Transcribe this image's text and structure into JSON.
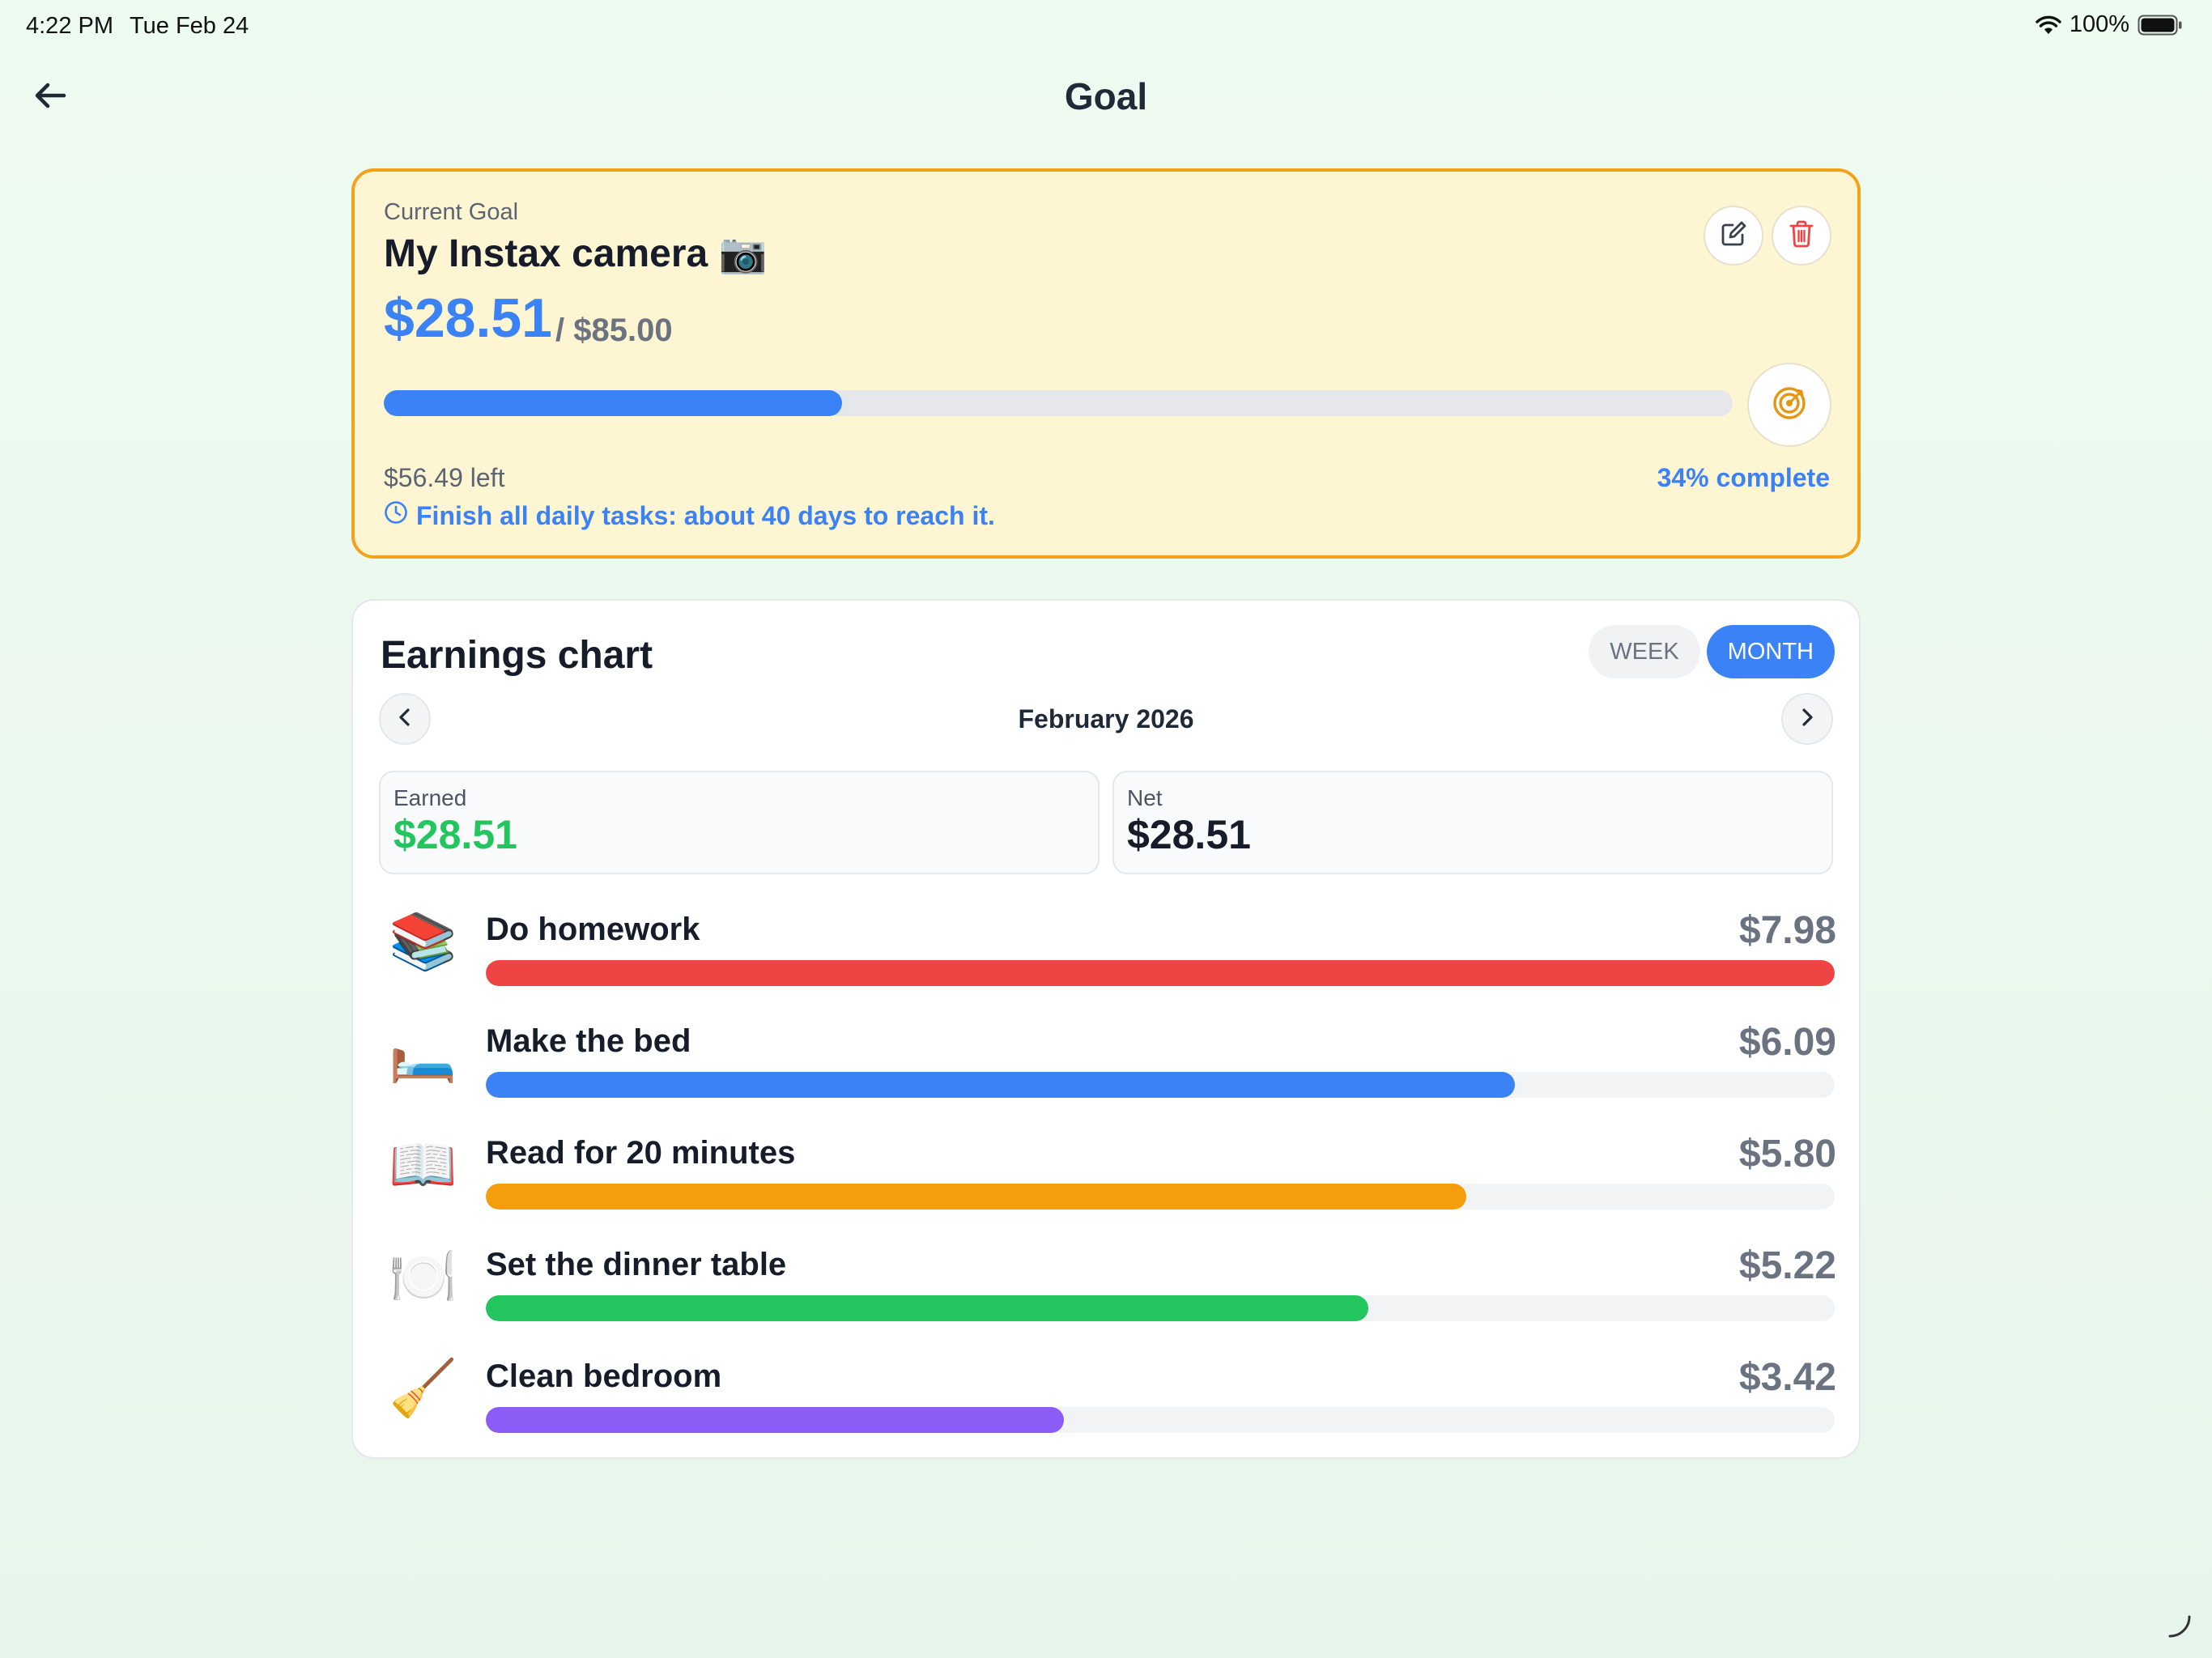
{
  "status_bar": {
    "time": "4:22 PM",
    "date": "Tue Feb 24",
    "battery": "100%"
  },
  "header": {
    "title": "Goal",
    "back_icon": "arrow-left-icon"
  },
  "goal": {
    "label": "Current Goal",
    "name": "My Instax camera 📷",
    "saved": "$28.51",
    "target": "/ $85.00",
    "progress_fraction": 0.34,
    "left_text": "$56.49 left",
    "complete_text": "34% complete",
    "estimate_text": "Finish all daily tasks: about 40 days to reach it.",
    "accent_color": "#3b82f6",
    "border_color": "#f2a21b"
  },
  "earnings": {
    "title": "Earnings chart",
    "toggle_week": "WEEK",
    "toggle_month": "MONTH",
    "selected_period": "MONTH",
    "month_label": "February 2026",
    "earned_label": "Earned",
    "earned_value": "$28.51",
    "net_label": "Net",
    "net_value": "$28.51",
    "tasks": [
      {
        "emoji": "📚",
        "name": "Do homework",
        "amount": "$7.98",
        "value": 7.98,
        "color": "#ef4444"
      },
      {
        "emoji": "🛏️",
        "name": "Make the bed",
        "amount": "$6.09",
        "value": 6.09,
        "color": "#3b82f6"
      },
      {
        "emoji": "📖",
        "name": "Read for 20 minutes",
        "amount": "$5.80",
        "value": 5.8,
        "color": "#f59e0b"
      },
      {
        "emoji": "🍽️",
        "name": "Set the dinner table",
        "amount": "$5.22",
        "value": 5.22,
        "color": "#22c55e"
      },
      {
        "emoji": "🧹",
        "name": "Clean bedroom",
        "amount": "$3.42",
        "value": 3.42,
        "color": "#8b5cf6"
      }
    ]
  }
}
